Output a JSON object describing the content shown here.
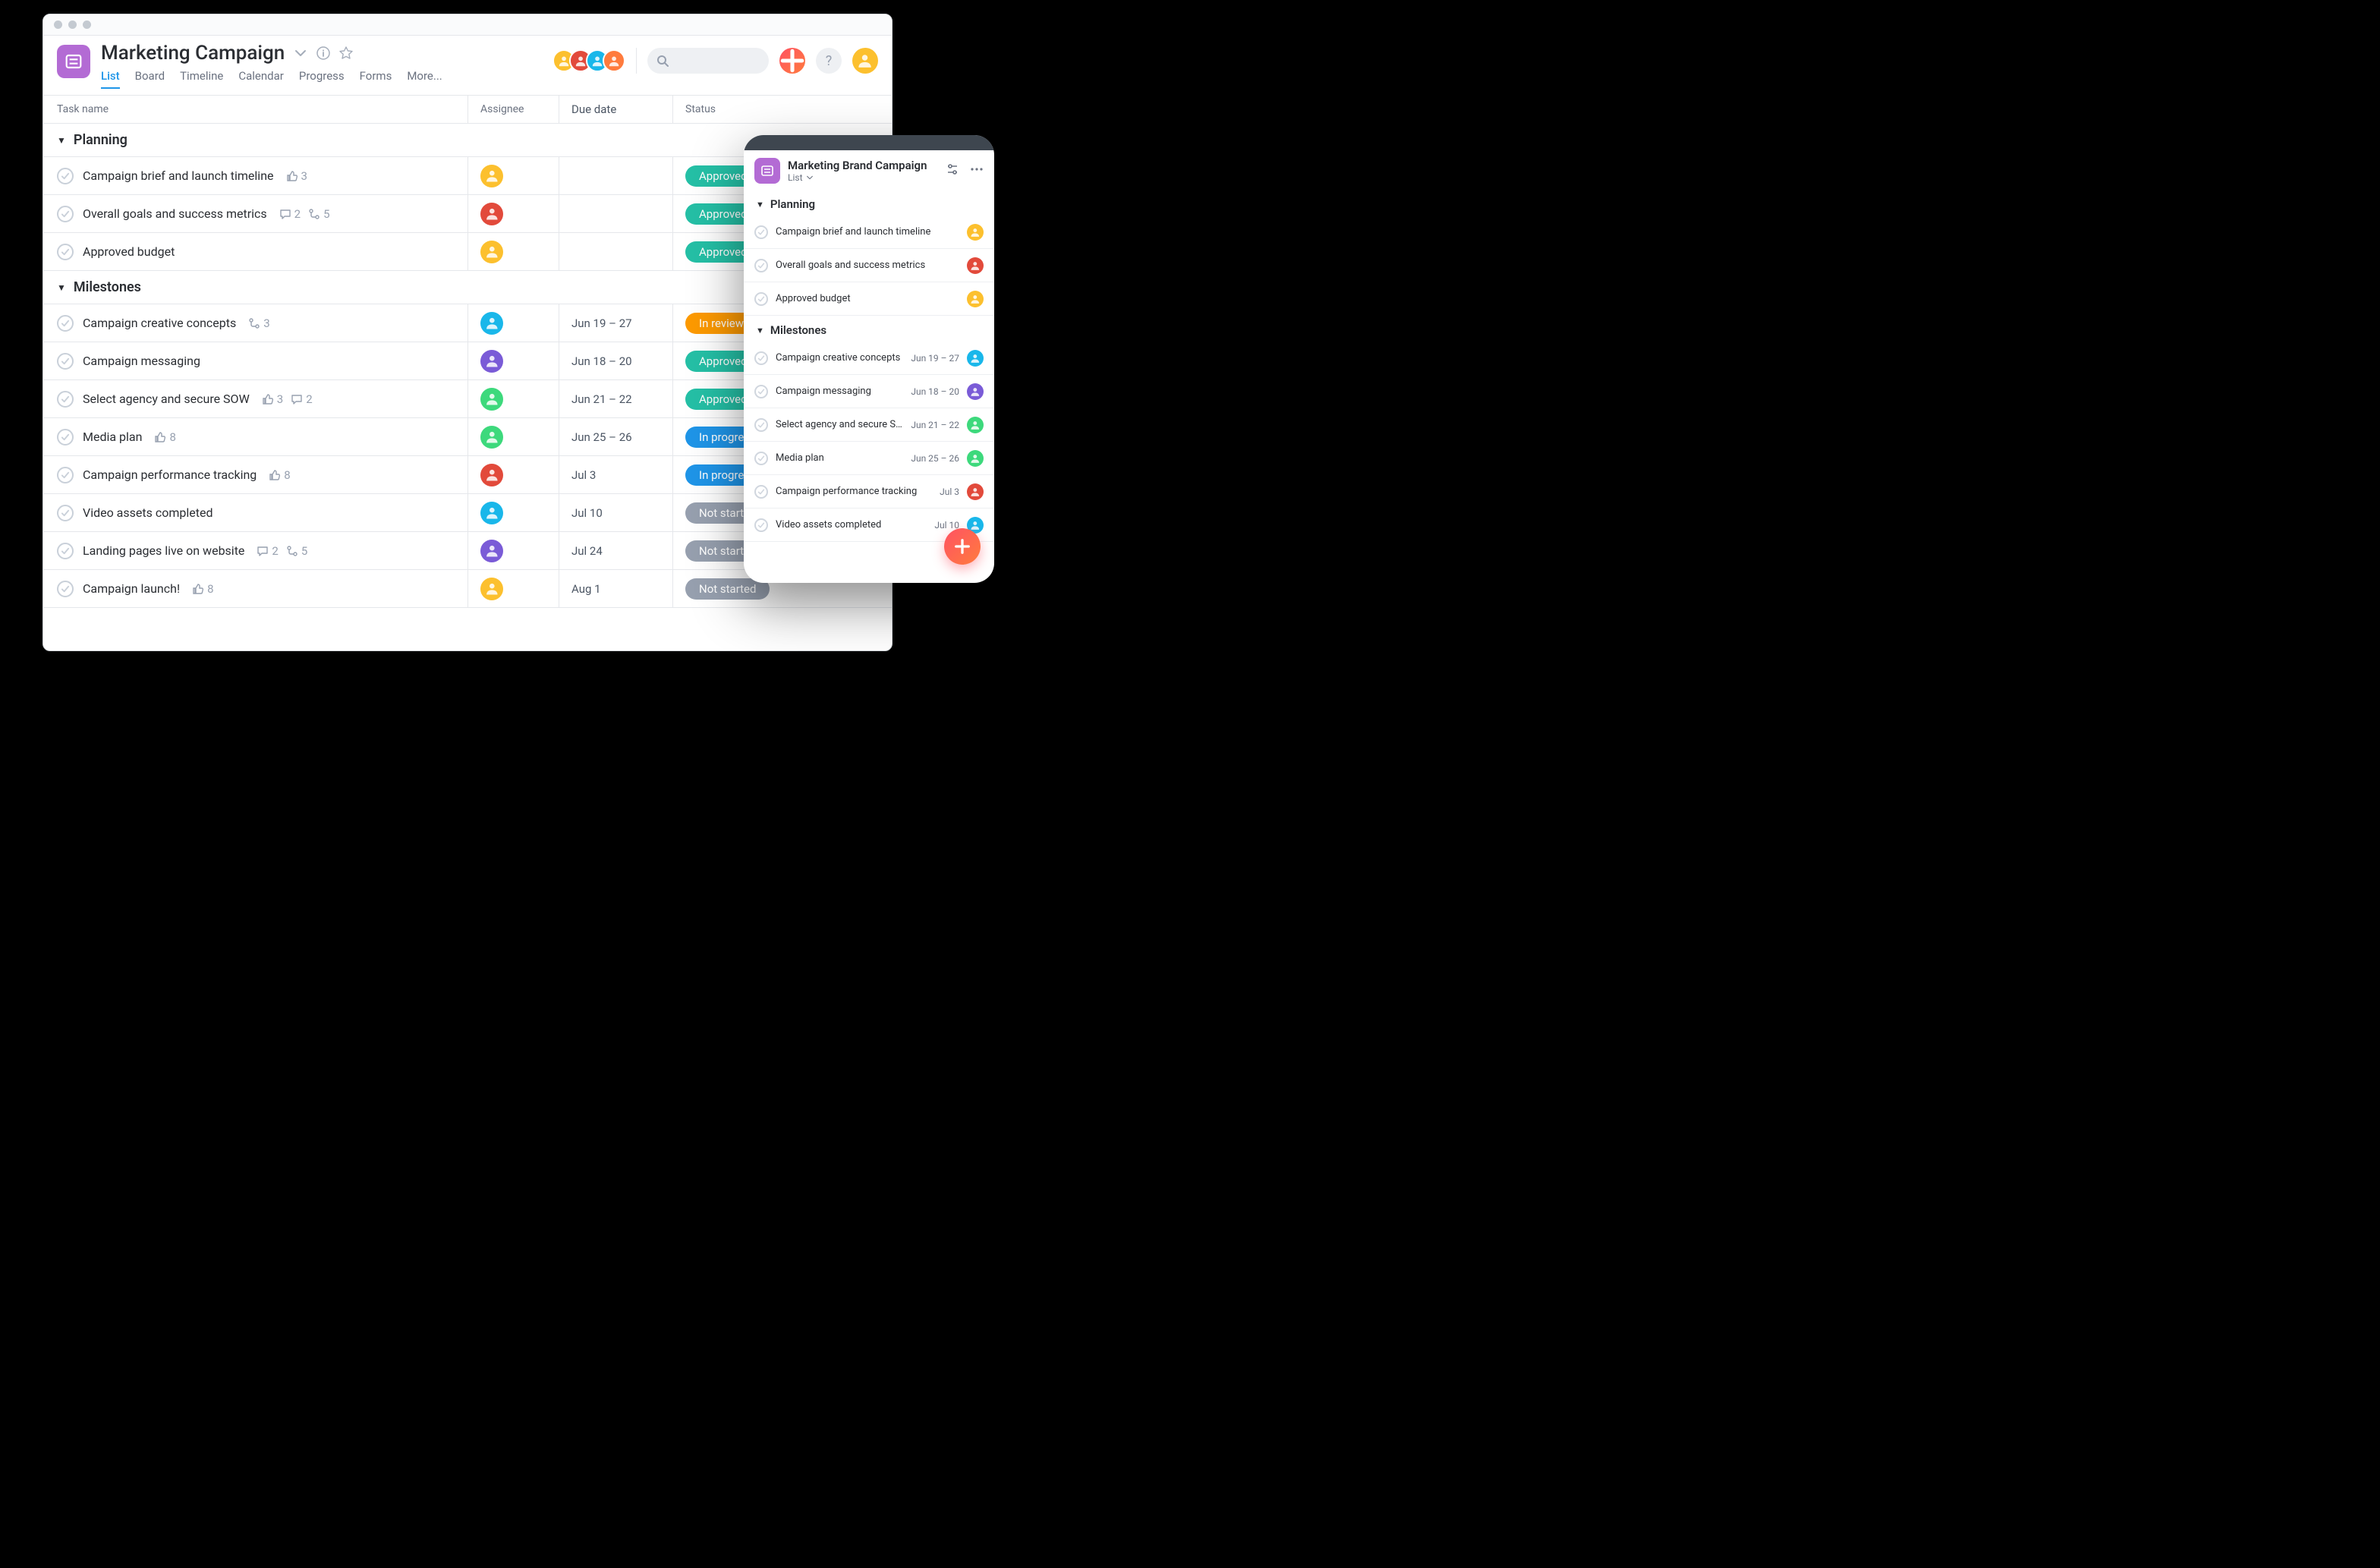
{
  "desktop": {
    "title": "Marketing Campaign",
    "tabs": [
      "List",
      "Board",
      "Timeline",
      "Calendar",
      "Progress",
      "Forms",
      "More..."
    ],
    "active_tab": "List",
    "columns": {
      "task": "Task name",
      "assignee": "Assignee",
      "due": "Due date",
      "status": "Status"
    },
    "facepile": [
      "yellow",
      "red",
      "cyan",
      "orange"
    ],
    "profile_avatar": "yellow",
    "sections": [
      {
        "name": "Planning",
        "tasks": [
          {
            "name": "Campaign brief and launch timeline",
            "likes": 3,
            "comments": null,
            "subtasks": null,
            "assignee": "yellow",
            "due": "",
            "status": "Approved"
          },
          {
            "name": "Overall goals and success metrics",
            "likes": null,
            "comments": 2,
            "subtasks": 5,
            "assignee": "red",
            "due": "",
            "status": "Approved"
          },
          {
            "name": "Approved budget",
            "likes": null,
            "comments": null,
            "subtasks": null,
            "assignee": "yellow",
            "due": "",
            "status": "Approved"
          }
        ]
      },
      {
        "name": "Milestones",
        "tasks": [
          {
            "name": "Campaign creative concepts",
            "likes": null,
            "comments": null,
            "subtasks": 3,
            "assignee": "cyan",
            "due": "Jun 19 – 27",
            "status": "In review"
          },
          {
            "name": "Campaign messaging",
            "likes": null,
            "comments": null,
            "subtasks": null,
            "assignee": "purple",
            "due": "Jun 18 – 20",
            "status": "Approved"
          },
          {
            "name": "Select agency and secure SOW",
            "likes": 3,
            "comments": 2,
            "subtasks": null,
            "assignee": "green",
            "due": "Jun 21 – 22",
            "status": "Approved"
          },
          {
            "name": "Media plan",
            "likes": 8,
            "comments": null,
            "subtasks": null,
            "assignee": "green",
            "due": "Jun 25 – 26",
            "status": "In progress"
          },
          {
            "name": "Campaign performance tracking",
            "likes": 8,
            "comments": null,
            "subtasks": null,
            "assignee": "red",
            "due": "Jul 3",
            "status": "In progress"
          },
          {
            "name": "Video assets completed",
            "likes": null,
            "comments": null,
            "subtasks": null,
            "assignee": "cyan",
            "due": "Jul 10",
            "status": "Not started"
          },
          {
            "name": "Landing pages live on website",
            "likes": null,
            "comments": 2,
            "subtasks": 5,
            "assignee": "purple",
            "due": "Jul 24",
            "status": "Not started"
          },
          {
            "name": "Campaign launch!",
            "likes": 8,
            "comments": null,
            "subtasks": null,
            "assignee": "yellow",
            "due": "Aug 1",
            "status": "Not started"
          }
        ]
      }
    ]
  },
  "mobile": {
    "title": "Marketing Brand Campaign",
    "view": "List",
    "sections": [
      {
        "name": "Planning",
        "tasks": [
          {
            "name": "Campaign brief and launch timeline",
            "due": "",
            "assignee": "yellow"
          },
          {
            "name": "Overall goals and success metrics",
            "due": "",
            "assignee": "red"
          },
          {
            "name": "Approved budget",
            "due": "",
            "assignee": "yellow"
          }
        ]
      },
      {
        "name": "Milestones",
        "tasks": [
          {
            "name": "Campaign creative concepts",
            "due": "Jun 19 – 27",
            "assignee": "cyan"
          },
          {
            "name": "Campaign messaging",
            "due": "Jun 18 – 20",
            "assignee": "purple"
          },
          {
            "name": "Select agency and secure SOW",
            "due": "Jun 21 – 22",
            "assignee": "green"
          },
          {
            "name": "Media plan",
            "due": "Jun 25 – 26",
            "assignee": "green"
          },
          {
            "name": "Campaign performance tracking",
            "due": "Jul 3",
            "assignee": "red"
          },
          {
            "name": "Video assets completed",
            "due": "Jul 10",
            "assignee": "cyan"
          }
        ]
      }
    ]
  },
  "status_styles": {
    "Approved": "p-approved",
    "In review": "p-inreview",
    "In progress": "p-inprogress",
    "Not started": "p-notstarted"
  }
}
